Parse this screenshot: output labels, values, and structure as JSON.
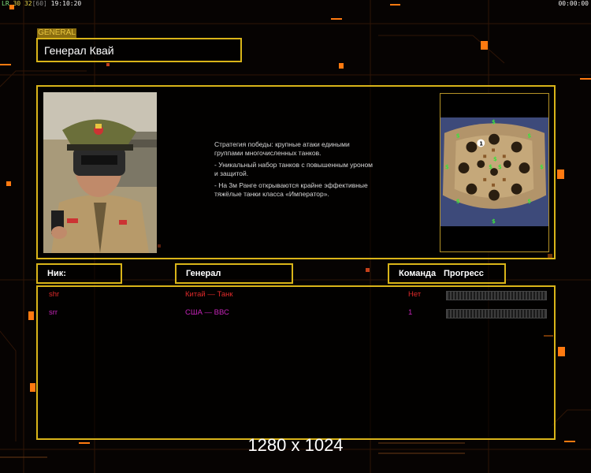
{
  "hud": {
    "left_prefix": "LR",
    "left_a": "30",
    "left_b": "32",
    "left_c": "[60]",
    "time": "19:10:20",
    "right_timer": "00:00:00"
  },
  "general_tag": "GENERAL",
  "title": "Генерал Квай",
  "description": [
    "Стратегия победы: крупные атаки едиными\n группами многочисленных танков.",
    "- Уникальный набор танков с повышенным уроном\n и защитой.",
    "- На 3м Ранге открываются крайне эффективные\n тяжёлые танки класса «Император»."
  ],
  "headers": {
    "nick": "Ник:",
    "general": "Генерал",
    "team": "Команда",
    "progress": "Прогресс"
  },
  "players": [
    {
      "nick": "shr",
      "general": "Китай — Танк",
      "team": "Нет",
      "progress": 0,
      "color": "#e02a2a"
    },
    {
      "nick": "srr",
      "general": "США — ВВС",
      "team": "1",
      "progress": 0,
      "color": "#c624b8"
    }
  ],
  "resolution": "1280 x 1024",
  "colors": {
    "accent": "#d9b419",
    "background": "#060302",
    "hud_orange": "#ff7a10"
  }
}
